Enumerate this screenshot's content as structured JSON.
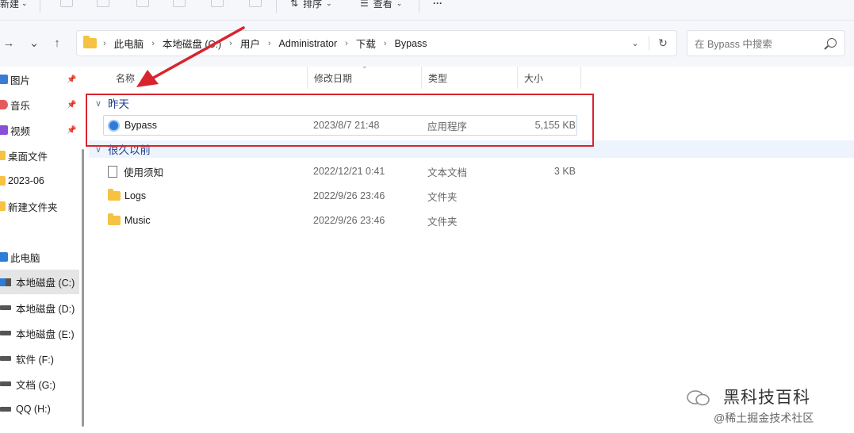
{
  "toolbar": {
    "new_label": "新建",
    "sort_label": "排序",
    "view_label": "查看",
    "more_label": "···"
  },
  "nav": {
    "back": "←",
    "forward": "→",
    "dropdown": "⌄",
    "up": "↑"
  },
  "breadcrumb": [
    "此电脑",
    "本地磁盘 (C:)",
    "用户",
    "Administrator",
    "下载",
    "Bypass"
  ],
  "search": {
    "placeholder": "在 Bypass 中搜索"
  },
  "sidebar": {
    "items": [
      {
        "label": "图片",
        "pinned": true,
        "color": "#3a7bd5"
      },
      {
        "label": "音乐",
        "pinned": true,
        "color": "#e55b5b"
      },
      {
        "label": "视频",
        "pinned": true,
        "color": "#8a4fd6"
      },
      {
        "label": "桌面文件",
        "pinned": false,
        "color": "#f5c242"
      },
      {
        "label": "2023-06",
        "pinned": false,
        "color": "#f5c242"
      },
      {
        "label": "新建文件夹",
        "pinned": false,
        "color": "#f5c242"
      }
    ],
    "this_pc": "此电脑",
    "drives": [
      "本地磁盘 (C:)",
      "本地磁盘 (D:)",
      "本地磁盘 (E:)",
      "软件 (F:)",
      "文档 (G:)",
      "QQ (H:)"
    ]
  },
  "columns": {
    "name": "名称",
    "modified": "修改日期",
    "type": "类型",
    "size": "大小"
  },
  "groups": [
    {
      "title": "昨天",
      "files": [
        {
          "name": "Bypass",
          "modified": "2023/8/7 21:48",
          "type": "应用程序",
          "size": "5,155 KB",
          "icon": "app-icon"
        }
      ]
    },
    {
      "title": "很久以前",
      "files": [
        {
          "name": "使用须知",
          "modified": "2022/12/21 0:41",
          "type": "文本文档",
          "size": "3 KB",
          "icon": "document-icon"
        },
        {
          "name": "Logs",
          "modified": "2022/9/26 23:46",
          "type": "文件夹",
          "size": "",
          "icon": "folder-icon"
        },
        {
          "name": "Music",
          "modified": "2022/9/26 23:46",
          "type": "文件夹",
          "size": "",
          "icon": "folder-icon"
        }
      ]
    }
  ],
  "watermark": {
    "title": "黑科技百科",
    "subtitle": "@稀土掘金技术社区"
  },
  "colors": {
    "highlight": "#d8242e",
    "accent": "#1e3f8a"
  }
}
